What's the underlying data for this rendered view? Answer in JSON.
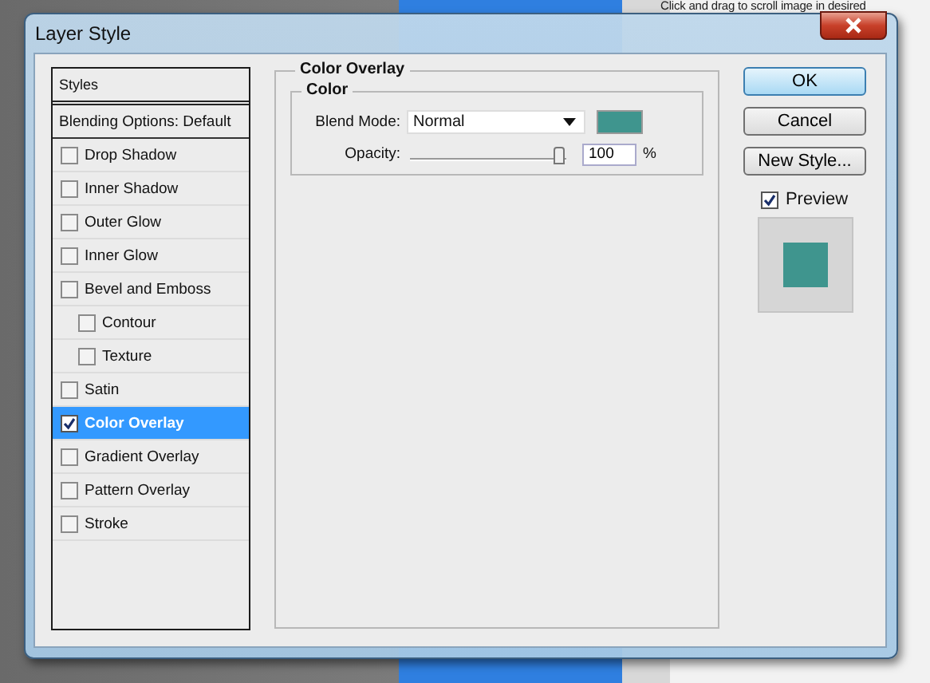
{
  "background": {
    "hint_text": "Click and drag to scroll image in desired"
  },
  "window": {
    "title": "Layer Style"
  },
  "styles_list": {
    "header": "Styles",
    "items": [
      {
        "label": "Blending Options: Default",
        "kind": "option",
        "selected": false
      },
      {
        "label": "Drop Shadow",
        "kind": "effect",
        "checked": false,
        "selected": false
      },
      {
        "label": "Inner Shadow",
        "kind": "effect",
        "checked": false,
        "selected": false
      },
      {
        "label": "Outer Glow",
        "kind": "effect",
        "checked": false,
        "selected": false
      },
      {
        "label": "Inner Glow",
        "kind": "effect",
        "checked": false,
        "selected": false
      },
      {
        "label": "Bevel and Emboss",
        "kind": "effect",
        "checked": false,
        "selected": false,
        "children": [
          {
            "label": "Contour",
            "kind": "effect",
            "checked": false,
            "selected": false
          },
          {
            "label": "Texture",
            "kind": "effect",
            "checked": false,
            "selected": false
          }
        ]
      },
      {
        "label": "Satin",
        "kind": "effect",
        "checked": false,
        "selected": false
      },
      {
        "label": "Color Overlay",
        "kind": "effect",
        "checked": true,
        "selected": true
      },
      {
        "label": "Gradient Overlay",
        "kind": "effect",
        "checked": false,
        "selected": false
      },
      {
        "label": "Pattern Overlay",
        "kind": "effect",
        "checked": false,
        "selected": false
      },
      {
        "label": "Stroke",
        "kind": "effect",
        "checked": false,
        "selected": false
      }
    ]
  },
  "panel": {
    "title": "Color Overlay",
    "group": {
      "title": "Color",
      "blend_mode": {
        "label": "Blend Mode:",
        "value": "Normal"
      },
      "color": "#3f958e",
      "opacity": {
        "label": "Opacity:",
        "level": 1,
        "value": "100",
        "unit": "%"
      }
    }
  },
  "buttons": [
    {
      "label": "OK",
      "default": true
    },
    {
      "label": "Cancel",
      "default": false
    },
    {
      "label": "New Style...",
      "default": false
    }
  ],
  "preview": {
    "label": "Preview",
    "checked": true
  }
}
